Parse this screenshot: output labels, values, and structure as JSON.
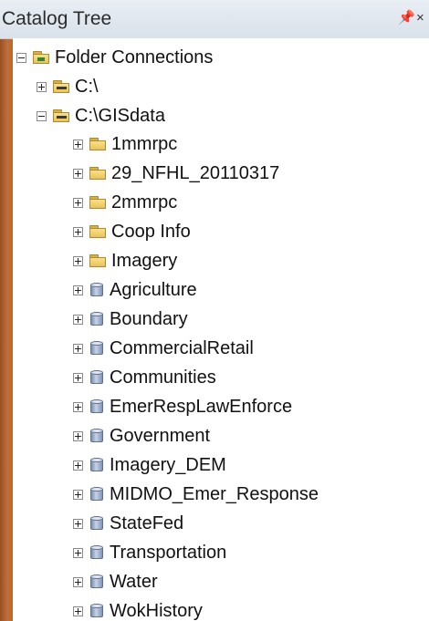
{
  "panel": {
    "title": "Catalog Tree",
    "pin_label": "Ѩ",
    "close_label": "×"
  },
  "tree": {
    "root": {
      "label": "Folder Connections",
      "expanded": true,
      "icon": "folder-connections-icon"
    },
    "drives": [
      {
        "label": "C:\\",
        "expanded": false,
        "icon": "folder-connection-icon"
      },
      {
        "label": "C:\\GISdata",
        "expanded": true,
        "icon": "folder-connection-icon"
      }
    ],
    "children": [
      {
        "label": "1mmrpc",
        "icon": "folder-icon"
      },
      {
        "label": "29_NFHL_20110317",
        "icon": "folder-icon"
      },
      {
        "label": "2mmrpc",
        "icon": "folder-icon"
      },
      {
        "label": "Coop Info",
        "icon": "folder-icon"
      },
      {
        "label": "Imagery",
        "icon": "folder-icon"
      },
      {
        "label": "Agriculture",
        "icon": "geodatabase-icon"
      },
      {
        "label": "Boundary",
        "icon": "geodatabase-icon"
      },
      {
        "label": "CommercialRetail",
        "icon": "geodatabase-icon"
      },
      {
        "label": "Communities",
        "icon": "geodatabase-icon"
      },
      {
        "label": "EmerRespLawEnforce",
        "icon": "geodatabase-icon"
      },
      {
        "label": "Government",
        "icon": "geodatabase-icon"
      },
      {
        "label": "Imagery_DEM",
        "icon": "geodatabase-icon"
      },
      {
        "label": "MIDMO_Emer_Response",
        "icon": "geodatabase-icon"
      },
      {
        "label": "StateFed",
        "icon": "geodatabase-icon"
      },
      {
        "label": "Transportation",
        "icon": "geodatabase-icon"
      },
      {
        "label": "Water",
        "icon": "geodatabase-icon"
      },
      {
        "label": "WokHistory",
        "icon": "geodatabase-icon"
      }
    ]
  },
  "colors": {
    "background": "#b5693a",
    "titlebar": "#e3e9f0",
    "tree_background": "#ffffff",
    "folder": "#e8c45a",
    "geodatabase": "#8194b6"
  }
}
